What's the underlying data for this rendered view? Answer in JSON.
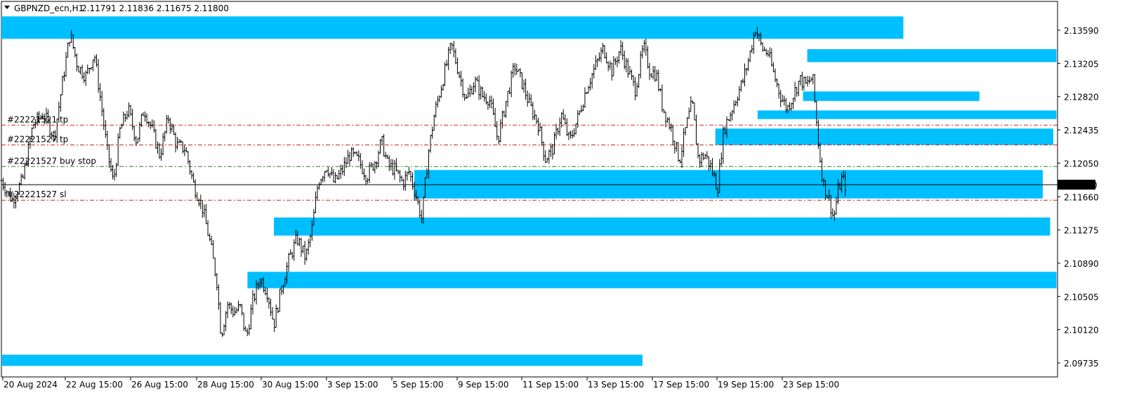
{
  "header": {
    "symbol": "GBPNZD_ecn,H1",
    "ohlc": "2.11791 2.11836 2.11675 2.11800"
  },
  "colors": {
    "zone": "#00BFFF",
    "candle": "#000000",
    "tp_line": "#D02020",
    "entry_line": "#208020",
    "bid_line": "#000000",
    "price_tag_bg": "#000000",
    "price_tag_text": "#FFFFFF"
  },
  "chart_data": {
    "type": "candlestick",
    "title": "GBPNZD_ecn,H1",
    "x_tick_labels": [
      "20 Aug 2024",
      "22 Aug 15:00",
      "26 Aug 15:00",
      "28 Aug 15:00",
      "30 Aug 15:00",
      "3 Sep 15:00",
      "5 Sep 15:00",
      "9 Sep 15:00",
      "11 Sep 15:00",
      "13 Sep 15:00",
      "17 Sep 15:00",
      "19 Sep 15:00",
      "23 Sep 15:00"
    ],
    "y_tick_labels": [
      "2.13590",
      "2.13205",
      "2.12820",
      "2.12435",
      "2.12050",
      "2.11660",
      "2.11275",
      "2.10890",
      "2.10505",
      "2.10120",
      "2.09735"
    ],
    "ylim": [
      2.0965,
      2.1393
    ],
    "current_price": 2.118,
    "current_price_label": "2.11800",
    "order_lines": [
      {
        "text": "#22221521 tp",
        "price": 2.1249,
        "kind": "tp"
      },
      {
        "text": "#22221527 tp",
        "price": 2.1226,
        "kind": "tp"
      },
      {
        "text": "#22221527 buy stop",
        "price": 2.1201,
        "kind": "entry"
      },
      {
        "text": "#22221527 sl",
        "price": 2.1162,
        "kind": "sl"
      }
    ],
    "zones": [
      {
        "x0": 0.0,
        "x1": 0.854,
        "top": 2.1375,
        "bottom": 2.1349
      },
      {
        "x0": 0.763,
        "x1": 0.999,
        "top": 2.1337,
        "bottom": 2.1322
      },
      {
        "x0": 0.759,
        "x1": 0.926,
        "top": 2.1288,
        "bottom": 2.1277
      },
      {
        "x0": 0.716,
        "x1": 0.999,
        "top": 2.1266,
        "bottom": 2.1256
      },
      {
        "x0": 0.676,
        "x1": 0.996,
        "top": 2.1245,
        "bottom": 2.1226
      },
      {
        "x0": 0.391,
        "x1": 0.986,
        "top": 2.1197,
        "bottom": 2.1164
      },
      {
        "x0": 0.258,
        "x1": 0.993,
        "top": 2.1142,
        "bottom": 2.1121
      },
      {
        "x0": 0.233,
        "x1": 0.999,
        "top": 2.1079,
        "bottom": 2.106
      },
      {
        "x0": 0.0,
        "x1": 0.607,
        "top": 2.0983,
        "bottom": 2.097
      }
    ],
    "price_path": [
      [
        0.0,
        2.1185
      ],
      [
        0.01,
        2.1162
      ],
      [
        0.02,
        2.1185
      ],
      [
        0.03,
        2.125
      ],
      [
        0.04,
        2.1262
      ],
      [
        0.05,
        2.1235
      ],
      [
        0.058,
        2.13
      ],
      [
        0.065,
        2.1355
      ],
      [
        0.072,
        2.1318
      ],
      [
        0.08,
        2.1306
      ],
      [
        0.088,
        2.1332
      ],
      [
        0.095,
        2.1268
      ],
      [
        0.1,
        2.122
      ],
      [
        0.106,
        2.1182
      ],
      [
        0.112,
        2.1242
      ],
      [
        0.12,
        2.1268
      ],
      [
        0.128,
        2.123
      ],
      [
        0.135,
        2.1268
      ],
      [
        0.142,
        2.1246
      ],
      [
        0.15,
        2.1214
      ],
      [
        0.158,
        2.1258
      ],
      [
        0.166,
        2.1225
      ],
      [
        0.174,
        2.1222
      ],
      [
        0.182,
        2.118
      ],
      [
        0.19,
        2.1155
      ],
      [
        0.198,
        2.111
      ],
      [
        0.204,
        2.1068
      ],
      [
        0.208,
        2.1005
      ],
      [
        0.214,
        2.1042
      ],
      [
        0.22,
        2.1032
      ],
      [
        0.226,
        2.1038
      ],
      [
        0.232,
        2.1002
      ],
      [
        0.238,
        2.1045
      ],
      [
        0.245,
        2.1072
      ],
      [
        0.252,
        2.1055
      ],
      [
        0.258,
        2.1018
      ],
      [
        0.265,
        2.106
      ],
      [
        0.272,
        2.1092
      ],
      [
        0.28,
        2.1118
      ],
      [
        0.288,
        2.1095
      ],
      [
        0.294,
        2.1128
      ],
      [
        0.3,
        2.1184
      ],
      [
        0.308,
        2.1202
      ],
      [
        0.315,
        2.1182
      ],
      [
        0.322,
        2.1195
      ],
      [
        0.33,
        2.1215
      ],
      [
        0.338,
        2.1208
      ],
      [
        0.346,
        2.119
      ],
      [
        0.354,
        2.1208
      ],
      [
        0.36,
        2.123
      ],
      [
        0.366,
        2.1202
      ],
      [
        0.372,
        2.1198
      ],
      [
        0.38,
        2.1182
      ],
      [
        0.386,
        2.1195
      ],
      [
        0.392,
        2.117
      ],
      [
        0.398,
        2.114
      ],
      [
        0.404,
        2.1215
      ],
      [
        0.41,
        2.1262
      ],
      [
        0.418,
        2.1302
      ],
      [
        0.426,
        2.1342
      ],
      [
        0.432,
        2.1315
      ],
      [
        0.44,
        2.1278
      ],
      [
        0.448,
        2.13
      ],
      [
        0.456,
        2.1282
      ],
      [
        0.462,
        2.128
      ],
      [
        0.47,
        2.1232
      ],
      [
        0.478,
        2.1278
      ],
      [
        0.486,
        2.1318
      ],
      [
        0.494,
        2.1295
      ],
      [
        0.5,
        2.1272
      ],
      [
        0.508,
        2.1252
      ],
      [
        0.515,
        2.121
      ],
      [
        0.522,
        2.1222
      ],
      [
        0.53,
        2.1262
      ],
      [
        0.538,
        2.123
      ],
      [
        0.546,
        2.1258
      ],
      [
        0.554,
        2.1292
      ],
      [
        0.562,
        2.1316
      ],
      [
        0.57,
        2.1338
      ],
      [
        0.578,
        2.1312
      ],
      [
        0.586,
        2.1338
      ],
      [
        0.594,
        2.131
      ],
      [
        0.6,
        2.129
      ],
      [
        0.608,
        2.134
      ],
      [
        0.614,
        2.1312
      ],
      [
        0.62,
        2.1308
      ],
      [
        0.626,
        2.127
      ],
      [
        0.634,
        2.1245
      ],
      [
        0.642,
        2.1208
      ],
      [
        0.648,
        2.1245
      ],
      [
        0.654,
        2.1275
      ],
      [
        0.66,
        2.1208
      ],
      [
        0.666,
        2.1215
      ],
      [
        0.672,
        2.12
      ],
      [
        0.678,
        2.1175
      ],
      [
        0.684,
        2.1245
      ],
      [
        0.69,
        2.1262
      ],
      [
        0.696,
        2.1282
      ],
      [
        0.702,
        2.13
      ],
      [
        0.708,
        2.1328
      ],
      [
        0.714,
        2.1362
      ],
      [
        0.72,
        2.1338
      ],
      [
        0.726,
        2.1332
      ],
      [
        0.732,
        2.1305
      ],
      [
        0.738,
        2.1282
      ],
      [
        0.744,
        2.1268
      ],
      [
        0.75,
        2.1285
      ],
      [
        0.756,
        2.1302
      ],
      [
        0.762,
        2.1295
      ],
      [
        0.768,
        2.1305
      ],
      [
        0.774,
        2.1222
      ],
      [
        0.778,
        2.1182
      ],
      [
        0.784,
        2.1162
      ],
      [
        0.788,
        2.114
      ],
      [
        0.792,
        2.1172
      ],
      [
        0.796,
        2.1188
      ],
      [
        0.8,
        2.1176
      ]
    ]
  }
}
